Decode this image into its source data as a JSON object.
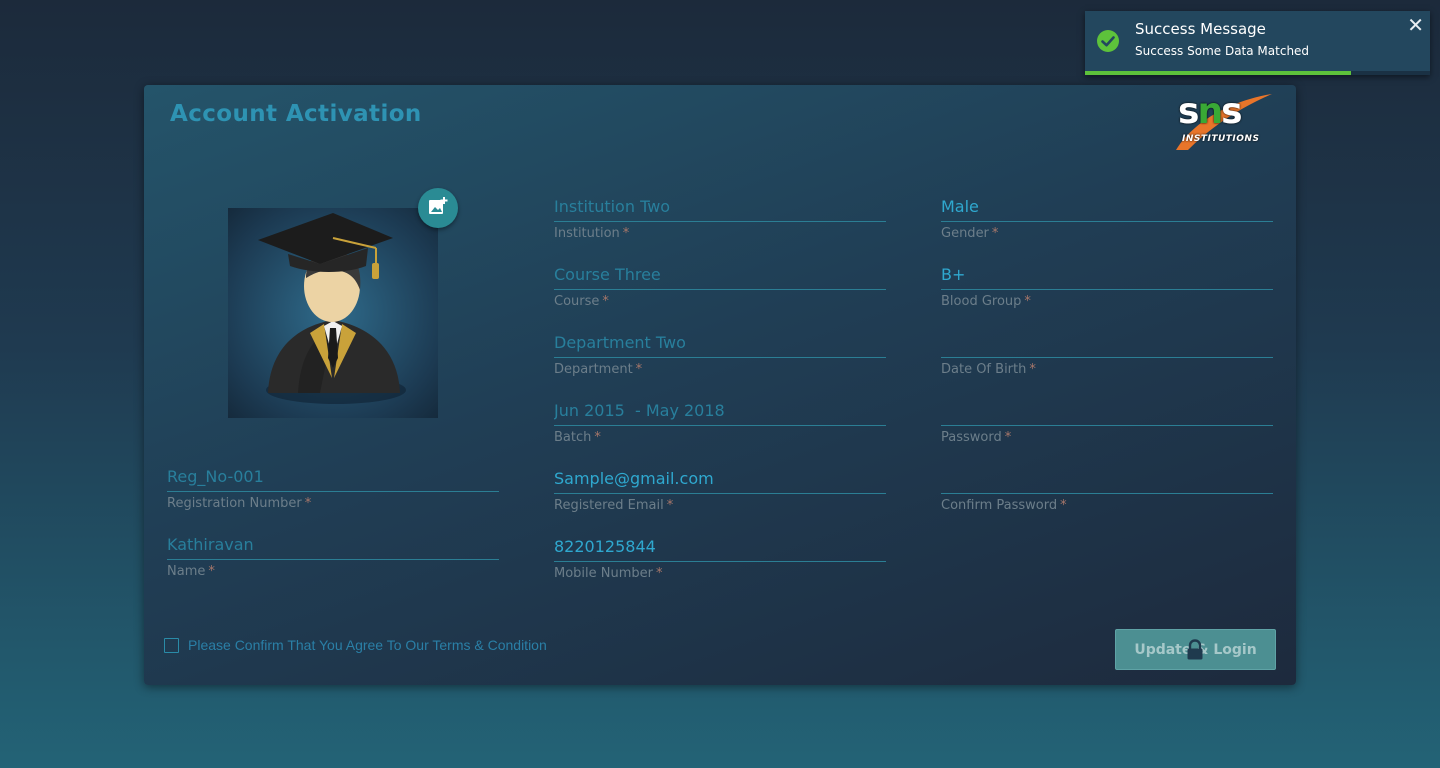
{
  "title": "Account Activation",
  "logo": {
    "text_left": "s",
    "text_mid": "n",
    "text_right": "s",
    "subtitle": "INSTITUTIONS"
  },
  "form": {
    "registration_number": {
      "value": "Reg_No-001",
      "label": "Registration Number",
      "required": "*"
    },
    "name": {
      "value": "Kathiravan",
      "label": "Name",
      "required": "*"
    },
    "institution": {
      "value": "Institution Two",
      "label": "Institution",
      "required": "*"
    },
    "course": {
      "value": "Course Three",
      "label": "Course",
      "required": "*"
    },
    "department": {
      "value": "Department Two",
      "label": "Department",
      "required": "*"
    },
    "batch": {
      "value": "Jun 2015  - May 2018",
      "label": "Batch",
      "required": "*"
    },
    "email": {
      "value": "Sample@gmail.com",
      "label": "Registered Email",
      "required": "*"
    },
    "mobile": {
      "value": "8220125844",
      "label": "Mobile Number",
      "required": "*"
    },
    "gender": {
      "value": "Male",
      "label": "Gender",
      "required": "*"
    },
    "blood_group": {
      "value": "B+",
      "label": "Blood Group",
      "required": "*"
    },
    "dob": {
      "value": "",
      "label": "Date Of Birth",
      "required": "*"
    },
    "password": {
      "value": "",
      "label": "Password",
      "required": "*"
    },
    "confirm_password": {
      "value": "",
      "label": "Confirm Password",
      "required": "*"
    }
  },
  "terms": {
    "label": "Please Confirm That You Agree To Our Terms & Condition",
    "checked": false
  },
  "submit": {
    "label": "Update & Login"
  },
  "toast": {
    "title": "Success Message",
    "message": "Success Some Data Matched",
    "close": "✕",
    "progress": 0.77
  },
  "colors": {
    "accent": "#2e93b3",
    "success": "#5dc23b",
    "button": "#4c8f92"
  },
  "icons": {
    "photo_add": "add-photo-icon",
    "lock": "lock-icon",
    "success": "check-circle-icon",
    "close": "close-icon"
  }
}
